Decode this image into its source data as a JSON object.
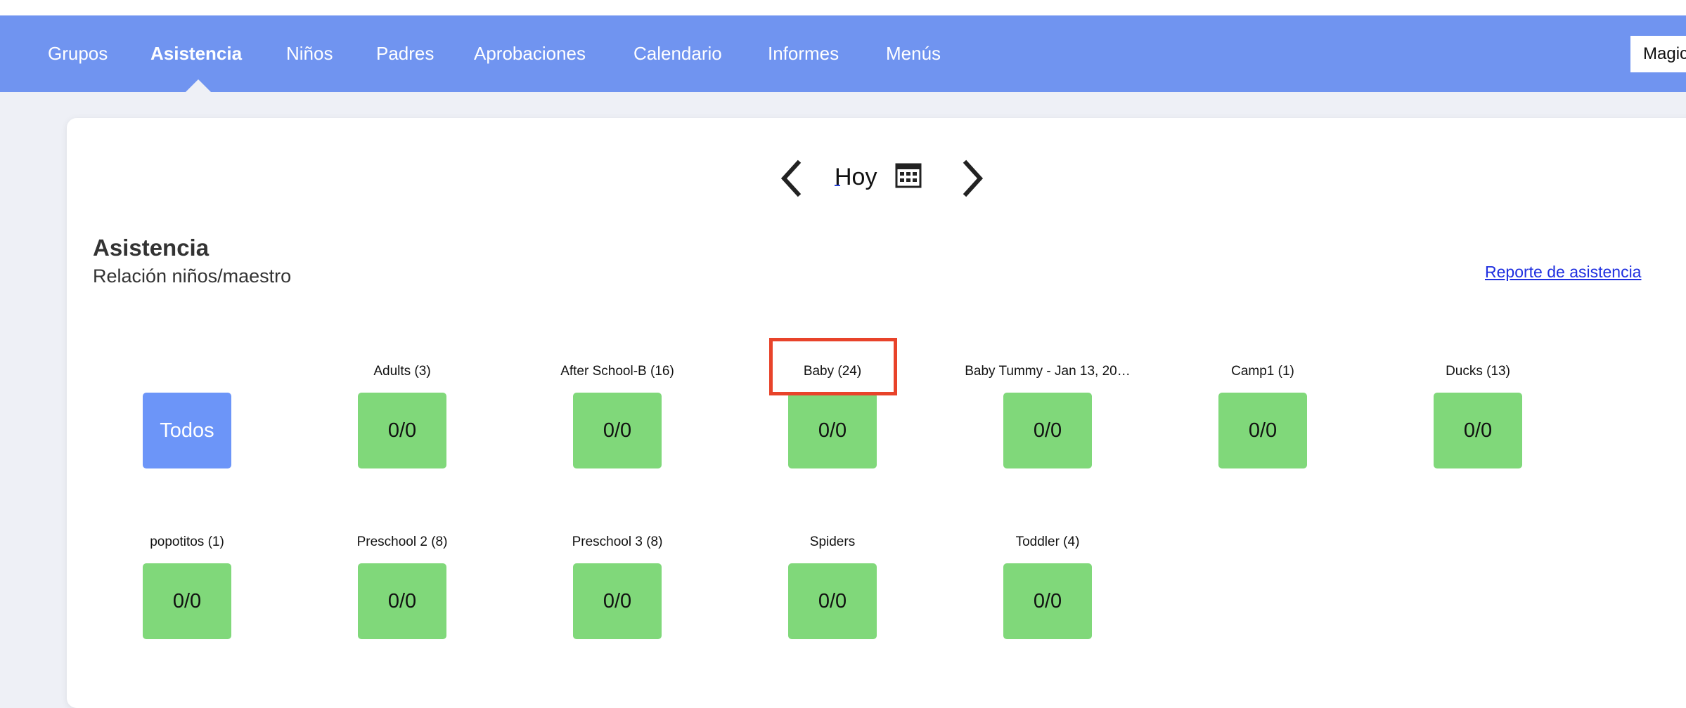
{
  "nav": {
    "items": [
      {
        "label": "Grupos",
        "active": false
      },
      {
        "label": "Asistencia",
        "active": true
      },
      {
        "label": "Niños",
        "active": false
      },
      {
        "label": "Padres",
        "active": false
      },
      {
        "label": "Aprobaciones",
        "active": false
      },
      {
        "label": "Calendario",
        "active": false
      },
      {
        "label": "Informes",
        "active": false
      },
      {
        "label": "Menús",
        "active": false
      }
    ],
    "org_selector": "Magic"
  },
  "date_nav": {
    "label": "Hoy",
    "prev_icon": "chevron-left-icon",
    "next_icon": "chevron-right-icon",
    "calendar_icon": "calendar-icon"
  },
  "page": {
    "title": "Asistencia",
    "subtitle": "Relación niños/maestro",
    "report_link": "Reporte de asistencia"
  },
  "groups": {
    "all_label": "Todos",
    "row1": [
      {
        "label": "Adults (3)",
        "ratio": "0/0"
      },
      {
        "label": "After School-B (16)",
        "ratio": "0/0"
      },
      {
        "label": "Baby (24)",
        "ratio": "0/0"
      },
      {
        "label": "Baby Tummy - Jan 13, 20…",
        "ratio": "0/0"
      },
      {
        "label": "Camp1 (1)",
        "ratio": "0/0"
      },
      {
        "label": "Ducks (13)",
        "ratio": "0/0"
      }
    ],
    "row2": [
      {
        "label": "popotitos (1)",
        "ratio": "0/0"
      },
      {
        "label": "Preschool 2 (8)",
        "ratio": "0/0"
      },
      {
        "label": "Preschool 3 (8)",
        "ratio": "0/0"
      },
      {
        "label": "Spiders",
        "ratio": "0/0"
      },
      {
        "label": "Toddler (4)",
        "ratio": "0/0"
      }
    ]
  },
  "colors": {
    "nav_bg": "#7094f0",
    "tile_green": "#80d87a",
    "tile_blue": "#6c95f8",
    "highlight": "#e8432a",
    "link": "#1f2fe0"
  }
}
